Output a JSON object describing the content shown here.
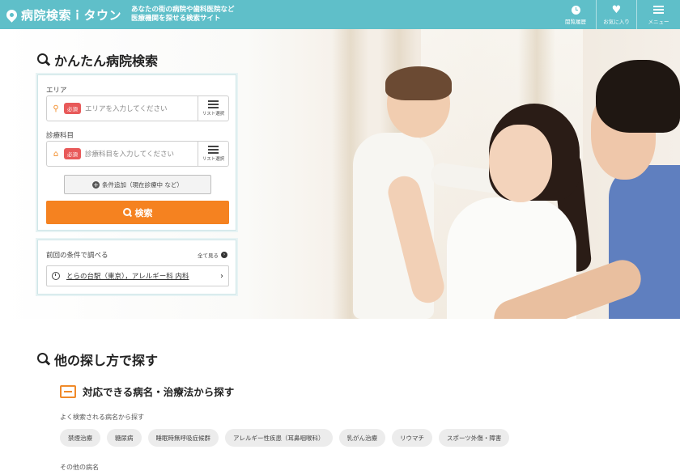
{
  "header": {
    "logo_text": "病院検索ｉタウン",
    "tagline_1": "あなたの街の病院や歯科医院など",
    "tagline_2": "医療機関を探せる検索サイト",
    "nav": [
      {
        "label": "閲覧履歴",
        "icon": "clock-icon"
      },
      {
        "label": "お気に入り",
        "icon": "heart-icon"
      },
      {
        "label": "メニュー",
        "icon": "menu-icon"
      }
    ]
  },
  "search": {
    "title": "かんたん病院検索",
    "area_label": "エリア",
    "area_required": "必須",
    "area_placeholder": "エリアを入力してください",
    "area_list_button": "リスト選択",
    "dept_label": "診療科目",
    "dept_required": "必須",
    "dept_placeholder": "診療科目を入力してください",
    "dept_list_button": "リスト選択",
    "add_condition": "条件追加（現在診療中 など）",
    "submit": "検索"
  },
  "recent": {
    "label": "前回の条件で調べる",
    "see_all": "全て見る",
    "item": "とらの台駅（東京），アレルギー科 内科"
  },
  "other": {
    "title": "他の探し方で探す",
    "subtitle": "対応できる病名・治療法から探す",
    "popular_label": "よく検索される病名から探す",
    "chips": [
      "禁煙治療",
      "糖尿病",
      "睡眠時無呼吸症候群",
      "アレルギー性疾患（耳鼻咽喉科）",
      "乳がん治療",
      "リウマチ",
      "スポーツ外傷・障害"
    ],
    "others_label": "その他の病名"
  },
  "colors": {
    "header": "#5fbfc9",
    "accent": "#f58220",
    "required": "#e85a5a"
  }
}
